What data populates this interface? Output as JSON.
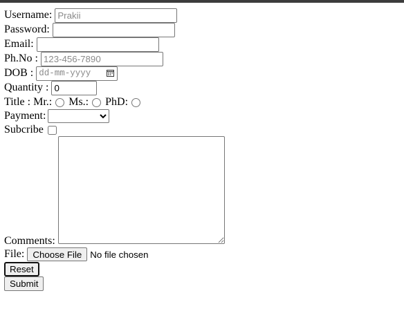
{
  "form": {
    "username": {
      "label": "Username:",
      "placeholder": "Prakii"
    },
    "password": {
      "label": "Password:"
    },
    "email": {
      "label": "Email:"
    },
    "phone": {
      "label": "Ph.No :",
      "placeholder": "123-456-7890"
    },
    "dob": {
      "label": "DOB :",
      "placeholder": "dd-mm-yyyy"
    },
    "quantity": {
      "label": "Quantity :",
      "value": "0"
    },
    "title": {
      "label": "Title :",
      "options": [
        "Mr.:",
        "Ms.:",
        "PhD:"
      ]
    },
    "payment": {
      "label": "Payment:",
      "selected": ""
    },
    "subscribe": {
      "label": "Subcribe"
    },
    "comments": {
      "label": "Comments:"
    },
    "file": {
      "label": "File:",
      "button_label": "Choose File",
      "status": "No file chosen"
    },
    "reset_label": "Reset",
    "submit_label": "Submit"
  }
}
